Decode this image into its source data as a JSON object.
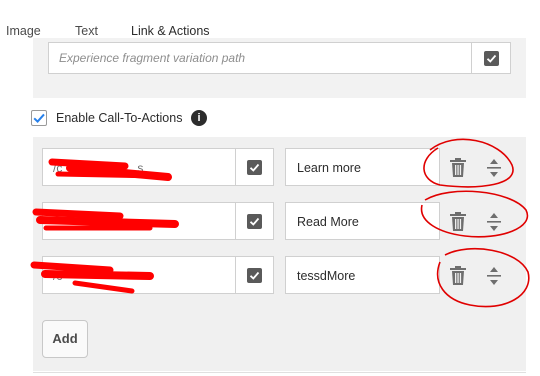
{
  "tabs": [
    {
      "label": "Image"
    },
    {
      "label": "Text"
    },
    {
      "label": "Link & Actions",
      "active": true
    }
  ],
  "fragment": {
    "placeholder": "Experience fragment variation path"
  },
  "cta": {
    "enable_label": "Enable Call-To-Actions",
    "enabled": true,
    "items": [
      {
        "link_prefix": "/c",
        "link_suffix": "s",
        "text": "Learn more"
      },
      {
        "link_prefix": "",
        "link_suffix": "",
        "text": "Read More"
      },
      {
        "link_prefix": "/c",
        "link_suffix": "",
        "text": "tessdMore"
      }
    ],
    "add_label": "Add"
  },
  "colors": {
    "accent_check": "#2680eb",
    "panel_bg": "#f0f0f0",
    "redaction": "#ff0000",
    "annotation": "#e00000"
  },
  "icons": [
    "info-icon",
    "checkmark-icon",
    "trash-icon",
    "move-handle-icon"
  ]
}
